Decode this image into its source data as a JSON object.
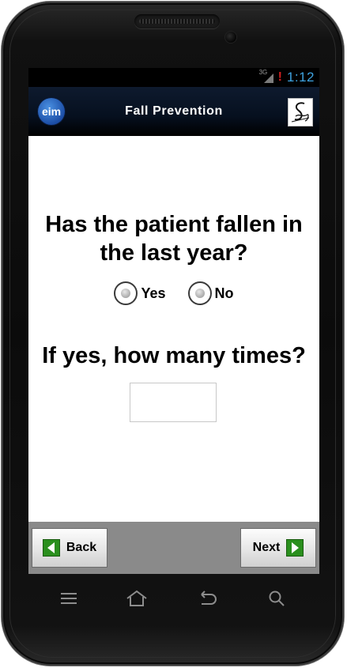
{
  "status_bar": {
    "network": "3G",
    "time": "1:12",
    "signal_icon": "signal-bars-icon",
    "alert_icon": "alert-exclamation-icon"
  },
  "header": {
    "logo_text": "eim",
    "title": "Fall Prevention",
    "signature_icon": "signature-icon"
  },
  "form": {
    "question_1": "Has the patient fallen in the last year?",
    "options": [
      {
        "label": "Yes",
        "selected": false
      },
      {
        "label": "No",
        "selected": false
      }
    ],
    "question_2": "If yes, how many times?",
    "count_value": ""
  },
  "footer": {
    "back_label": "Back",
    "next_label": "Next",
    "arrow_color": "#2a8f1d"
  },
  "softkeys": [
    "menu-icon",
    "home-icon",
    "back-arrow-icon",
    "search-icon"
  ]
}
